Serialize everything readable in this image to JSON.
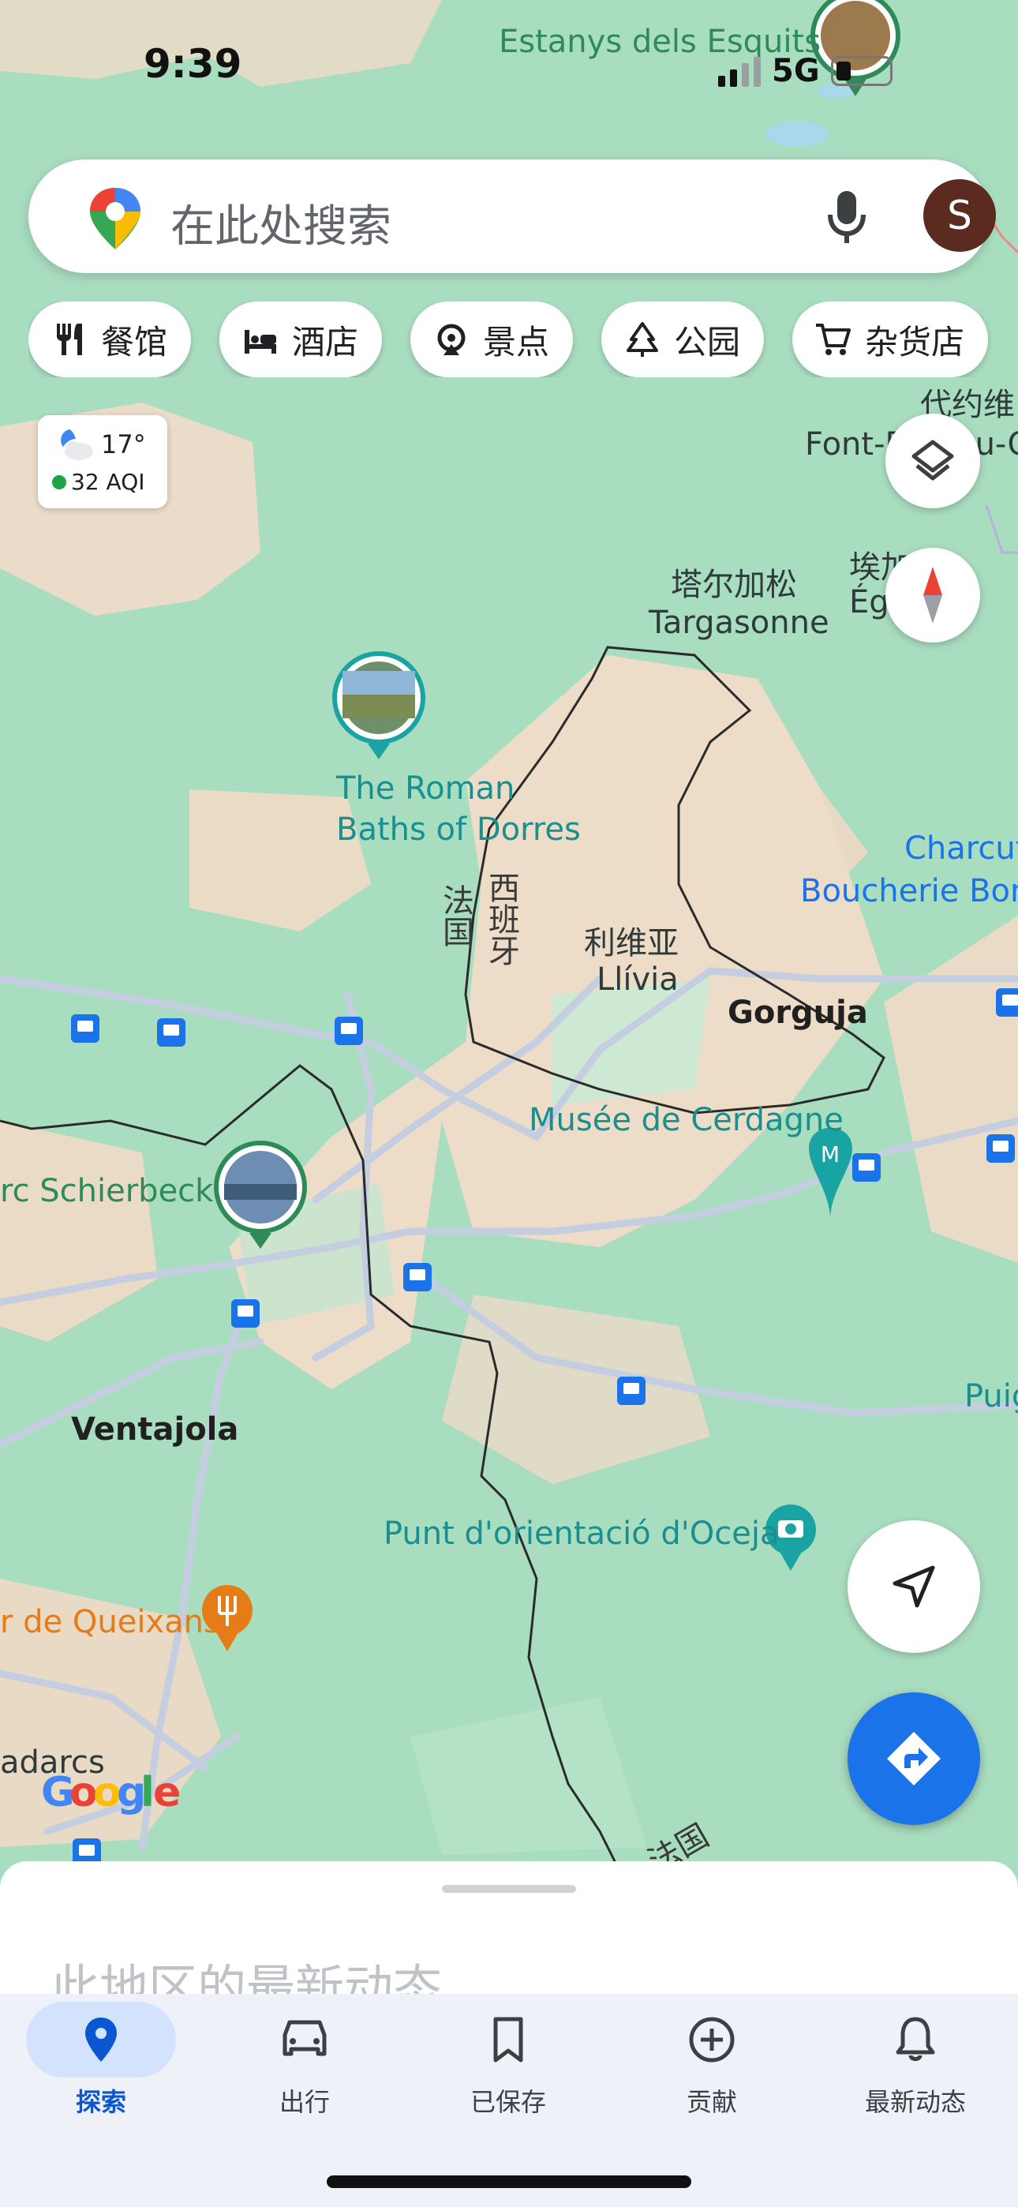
{
  "status_bar": {
    "time": "9:39",
    "network": "5G"
  },
  "search": {
    "placeholder": "在此处搜索",
    "avatar_initial": "S"
  },
  "chips": [
    {
      "label": "餐馆",
      "icon": "restaurant-icon"
    },
    {
      "label": "酒店",
      "icon": "hotel-icon"
    },
    {
      "label": "景点",
      "icon": "attraction-icon"
    },
    {
      "label": "公园",
      "icon": "park-icon"
    },
    {
      "label": "杂货店",
      "icon": "grocery-icon"
    }
  ],
  "weather": {
    "temperature": "17°",
    "aqi": "32 AQI",
    "icon": "partly-cloudy-night-icon"
  },
  "map": {
    "labels": {
      "estanys": "Estanys dels Esquits",
      "targasonne_zh": "塔尔加松",
      "targasonne": "Targasonne",
      "font_zh": "代约维",
      "font": "Font-Romeu-O",
      "egat_zh": "埃加",
      "egat": "Égat",
      "roman_baths_1": "The Roman",
      "roman_baths_2": "Baths of Dorres",
      "france_zh": "法国",
      "spain_zh": "西班牙",
      "llivia_zh": "利维亚",
      "llivia": "Llívia",
      "gorguja": "Gorguja",
      "charcut_1": "Charcut",
      "charcut_2": "Boucherie Bon",
      "musee": "Musée de Cerdagne",
      "schierbeck": "rc Schierbeck",
      "ventajola": "Ventajola",
      "puig": "Puig",
      "punt": "Punt d'orientació d'Oceja",
      "queixans": "r de Queixans",
      "adarcs": "adarcs",
      "france_bottom": "法国"
    },
    "colors": {
      "green": "#a9ddc0",
      "tan": "#ecdcc8",
      "road": "#c5cde0",
      "poi_green": "#2e8b57",
      "poi_teal": "#1aa3a3",
      "poi_orange": "#e67c17"
    }
  },
  "sheet": {
    "title": "此地区的最新动态..."
  },
  "bottom_nav": [
    {
      "label": "探索",
      "icon": "location-pin-icon",
      "active": true
    },
    {
      "label": "出行",
      "icon": "car-icon",
      "active": false
    },
    {
      "label": "已保存",
      "icon": "bookmark-icon",
      "active": false
    },
    {
      "label": "贡献",
      "icon": "add-circle-icon",
      "active": false
    },
    {
      "label": "最新动态",
      "icon": "bell-icon",
      "active": false
    }
  ]
}
